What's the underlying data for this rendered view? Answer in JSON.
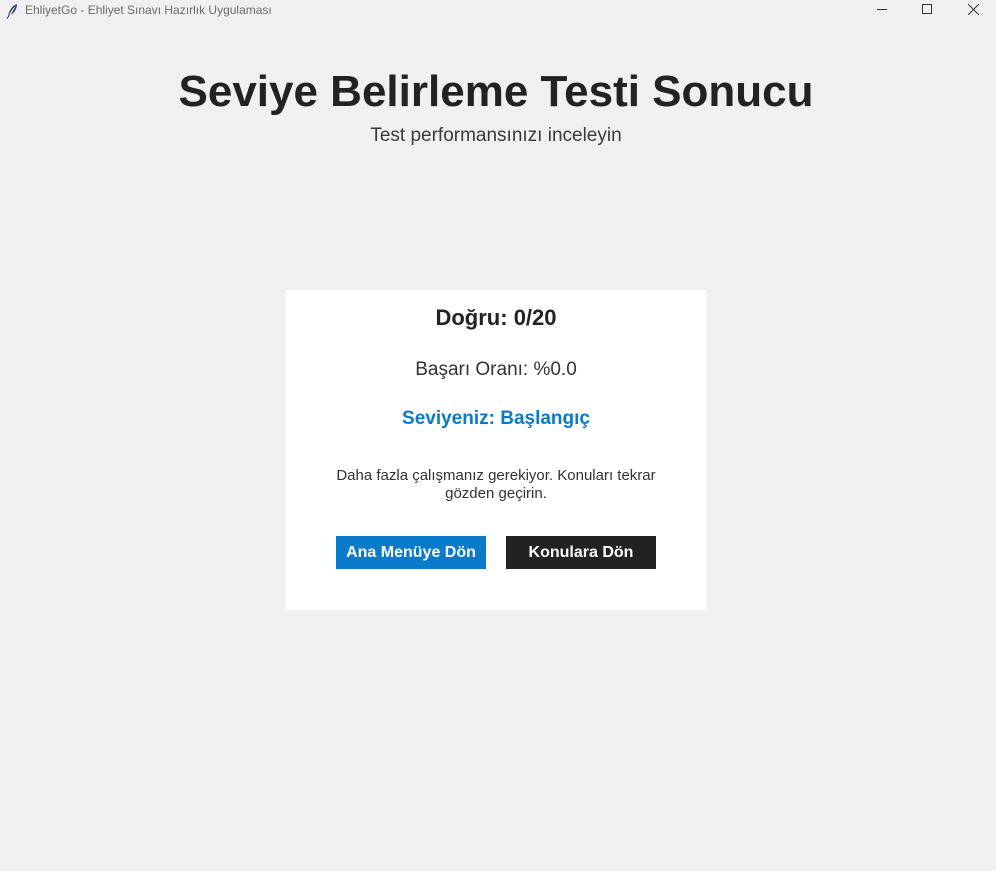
{
  "window": {
    "title": "EhliyetGo - Ehliyet Sınavı Hazırlık Uygulaması",
    "icon": "feather-icon",
    "controls": [
      "minimize-icon",
      "maximize-icon",
      "close-icon"
    ]
  },
  "header": {
    "title": "Seviye Belirleme Testi Sonucu",
    "subtitle": "Test performansınızı inceleyin"
  },
  "result": {
    "score": "Doğru: 0/20",
    "success_rate": "Başarı Oranı: %0.0",
    "level": "Seviyeniz: Başlangıç",
    "advice": "Daha fazla çalışmanız gerekiyor. Konuları tekrar gözden geçirin."
  },
  "actions": {
    "main_menu_label": "Ana Menüye Dön",
    "topics_label": "Konulara Dön"
  },
  "colors": {
    "background": "#f0f0f0",
    "card": "#ffffff",
    "accent_blue": "#0a7acb",
    "dark_button": "#222222",
    "title_text": "#222222"
  }
}
